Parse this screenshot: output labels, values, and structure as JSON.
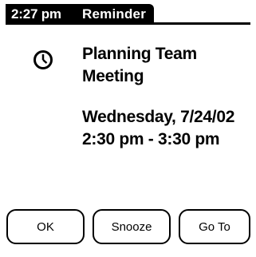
{
  "titlebar": {
    "time": "2:27 pm",
    "title": "Reminder"
  },
  "alarm": {
    "icon": "clock-icon",
    "event_line1": "Planning Team",
    "event_line2": "Meeting",
    "date": "Wednesday, 7/24/02",
    "time_range": "2:30 pm - 3:30 pm"
  },
  "buttons": {
    "ok": "OK",
    "snooze": "Snooze",
    "goto": "Go To"
  }
}
